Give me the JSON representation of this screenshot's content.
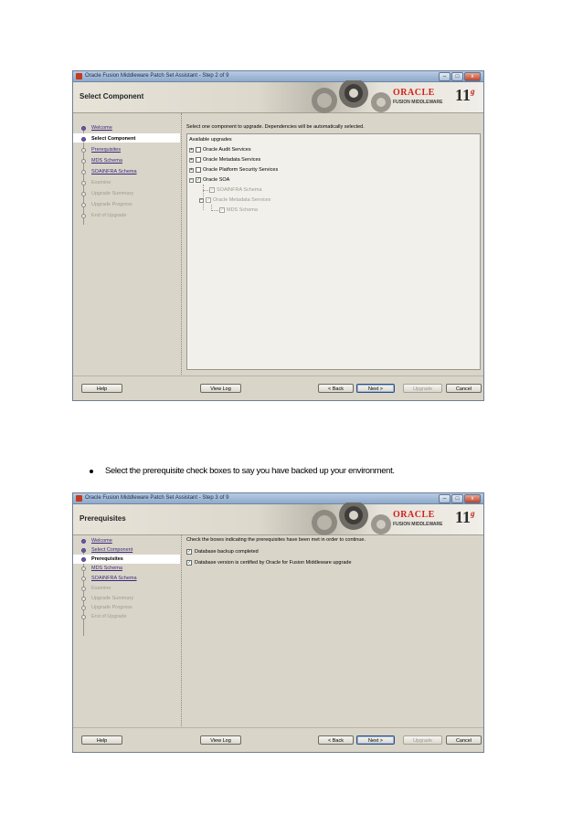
{
  "bullet_text": "Select the prerequisite check boxes to say you have backed up your environment.",
  "brand": {
    "oracle": "ORACLE",
    "fmw": "FUSION MIDDLEWARE",
    "version": "11",
    "version_suffix": "g"
  },
  "colors": {
    "oracle_red": "#d0201a",
    "link_purple": "#3b2a7c",
    "window_bg": "#d9d5c9"
  },
  "window_buttons": [
    "–",
    "□",
    "x"
  ],
  "buttons": {
    "help": "Help",
    "view_log": "View Log",
    "back": "< Back",
    "next": "Next >",
    "upgrade": "Upgrade",
    "cancel": "Cancel"
  },
  "screens": [
    {
      "window_title": "Oracle Fusion Middleware Patch Set Assistant - Step 2 of 9",
      "step_title": "Select Component",
      "nav": [
        {
          "label": "Welcome",
          "state": "link"
        },
        {
          "label": "Select Component",
          "state": "current"
        },
        {
          "label": "Prerequisites",
          "state": "link"
        },
        {
          "label": "MDS Schema",
          "state": "link"
        },
        {
          "label": "SOAINFRA Schema",
          "state": "link"
        },
        {
          "label": "Examine",
          "state": "disabled"
        },
        {
          "label": "Upgrade Summary",
          "state": "disabled"
        },
        {
          "label": "Upgrade Progress",
          "state": "disabled"
        },
        {
          "label": "End of Upgrade",
          "state": "disabled"
        }
      ],
      "instruction": "Select one component to upgrade. Dependencies will be automatically selected.",
      "tree_header": "Available upgrades",
      "tree": [
        {
          "label": "Oracle Audit Services",
          "checked": false,
          "level": 0,
          "disabled": false
        },
        {
          "label": "Oracle Metadata Services",
          "checked": false,
          "level": 0,
          "disabled": false
        },
        {
          "label": "Oracle Platform Security Services",
          "checked": false,
          "level": 0,
          "disabled": false
        },
        {
          "label": "Oracle SOA",
          "checked": true,
          "level": 0,
          "disabled": false
        },
        {
          "label": "SOAINFRA Schema",
          "checked": true,
          "level": 1,
          "disabled": true
        },
        {
          "label": "Oracle Metadata Services",
          "checked": true,
          "level": 1,
          "disabled": true
        },
        {
          "label": "MDS Schema",
          "checked": true,
          "level": 2,
          "disabled": true
        }
      ]
    },
    {
      "window_title": "Oracle Fusion Middleware Patch Set Assistant - Step 3 of 9",
      "step_title": "Prerequisites",
      "nav": [
        {
          "label": "Welcome",
          "state": "link"
        },
        {
          "label": "Select Component",
          "state": "link"
        },
        {
          "label": "Prerequisites",
          "state": "current"
        },
        {
          "label": "MDS Schema",
          "state": "link"
        },
        {
          "label": "SOAINFRA Schema",
          "state": "link"
        },
        {
          "label": "Examine",
          "state": "disabled"
        },
        {
          "label": "Upgrade Summary",
          "state": "disabled"
        },
        {
          "label": "Upgrade Progress",
          "state": "disabled"
        },
        {
          "label": "End of Upgrade",
          "state": "disabled"
        }
      ],
      "instruction": "Check the boxes indicating the prerequisites have been met in order to continue.",
      "checks": [
        {
          "label": "Database backup completed",
          "checked": true
        },
        {
          "label": "Database version is certified by Oracle for Fusion Middleware upgrade",
          "checked": true
        }
      ]
    }
  ]
}
